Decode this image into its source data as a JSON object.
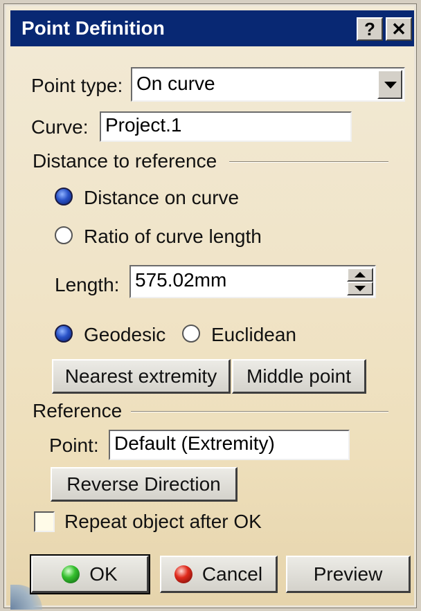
{
  "window": {
    "title": "Point Definition",
    "help_label": "?",
    "close_label": "✕"
  },
  "point_type": {
    "label": "Point type:",
    "value": "On curve"
  },
  "curve": {
    "label": "Curve:",
    "value": "Project.1"
  },
  "distance_group": {
    "title": "Distance to reference",
    "radio_distance": {
      "label": "Distance on curve",
      "checked": true
    },
    "radio_ratio": {
      "label": "Ratio of curve length",
      "checked": false
    },
    "length": {
      "label": "Length:",
      "value": "575.02mm"
    },
    "radio_geodesic": {
      "label": "Geodesic",
      "checked": true
    },
    "radio_euclidean": {
      "label": "Euclidean",
      "checked": false
    },
    "nearest_button": "Nearest extremity",
    "middle_button": "Middle point"
  },
  "reference_group": {
    "title": "Reference",
    "point": {
      "label": "Point:",
      "value": "Default (Extremity)"
    },
    "reverse_button": "Reverse Direction"
  },
  "repeat": {
    "label": "Repeat object after OK",
    "checked": false
  },
  "footer": {
    "ok_label": "OK",
    "cancel_label": "Cancel",
    "preview_label": "Preview"
  },
  "colors": {
    "title_bar": "#082873",
    "dialog_bg": "#f0e4c8"
  }
}
